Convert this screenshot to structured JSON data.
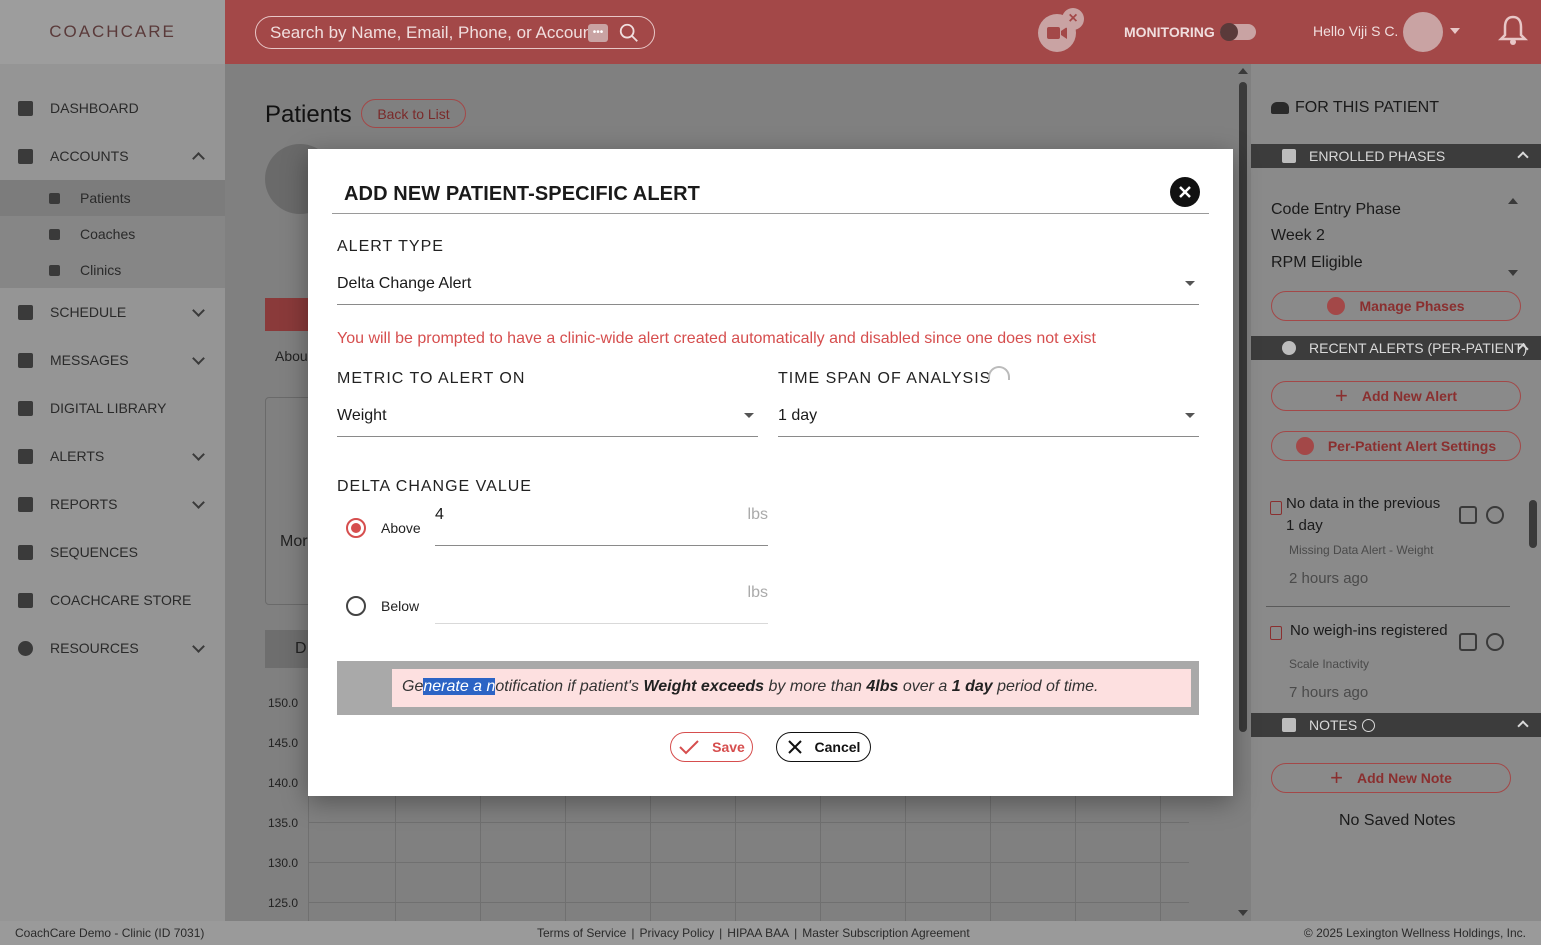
{
  "header": {
    "logo": "COACHCARE",
    "search_placeholder": "Search by Name, Email, Phone, or Account I",
    "monitoring_label": "MONITORING",
    "greeting": "Hello Viji S C."
  },
  "sidebar": {
    "items": [
      {
        "label": "DASHBOARD"
      },
      {
        "label": "ACCOUNTS"
      },
      {
        "label": "SCHEDULE"
      },
      {
        "label": "MESSAGES"
      },
      {
        "label": "DIGITAL LIBRARY"
      },
      {
        "label": "ALERTS"
      },
      {
        "label": "REPORTS"
      },
      {
        "label": "SEQUENCES"
      },
      {
        "label": "COACHCARE STORE"
      },
      {
        "label": "RESOURCES"
      }
    ],
    "sub_items": [
      {
        "label": "Patients"
      },
      {
        "label": "Coaches"
      },
      {
        "label": "Clinics"
      }
    ]
  },
  "main": {
    "title": "Patients",
    "back_button": "Back to List",
    "about_tab": "Abou",
    "monitor_label": "Mor",
    "tab_label": "D",
    "y_ticks": [
      "150.0",
      "145.0",
      "140.0",
      "135.0",
      "130.0",
      "125.0"
    ]
  },
  "right_panel": {
    "heading": "FOR THIS PATIENT",
    "enrolled_title": "ENROLLED PHASES",
    "phases": [
      "Code Entry Phase",
      "Week 2",
      "RPM Eligible"
    ],
    "manage_phases": "Manage Phases",
    "recent_alerts_title": "RECENT ALERTS (PER-PATIENT)",
    "add_new_alert": "Add New Alert",
    "per_patient_settings": "Per-Patient Alert Settings",
    "alerts": [
      {
        "title_line1": "No data in the previous",
        "title_line2": "1 day",
        "subtitle": "Missing Data Alert - Weight",
        "time": "2 hours ago"
      },
      {
        "title_line1": "No weigh-ins registered",
        "title_line2": "",
        "subtitle": "Scale Inactivity",
        "time": "7 hours ago"
      }
    ],
    "notes_title": "NOTES",
    "add_new_note": "Add New Note",
    "no_notes": "No Saved Notes"
  },
  "footer": {
    "clinic": "CoachCare Demo - Clinic (ID 7031)",
    "links": [
      "Terms of Service",
      "Privacy Policy",
      "HIPAA BAA",
      "Master Subscription Agreement"
    ],
    "copyright": "© 2025 Lexington Wellness Holdings, Inc."
  },
  "modal": {
    "title": "ADD NEW PATIENT-SPECIFIC ALERT",
    "alert_type_label": "ALERT TYPE",
    "alert_type_value": "Delta Change Alert",
    "warning": "You will be prompted to have a clinic-wide alert created automatically and disabled since one does not exist",
    "metric_label": "METRIC TO ALERT ON",
    "metric_value": "Weight",
    "timespan_label": "TIME SPAN OF ANALYSIS",
    "timespan_value": "1 day",
    "delta_label": "DELTA CHANGE VALUE",
    "above_label": "Above",
    "above_value": "4",
    "below_label": "Below",
    "below_value": "",
    "unit": "lbs",
    "summary": {
      "pre": "Ge",
      "highlight": "nerate a n",
      "mid1": "otification if patient's ",
      "metric_exceeds": "Weight exceeds",
      "mid2": " by more than ",
      "amount": "4lbs",
      "mid3": " over a ",
      "span": "1 day",
      "post": " period of time."
    },
    "save_label": "Save",
    "cancel_label": "Cancel"
  }
}
